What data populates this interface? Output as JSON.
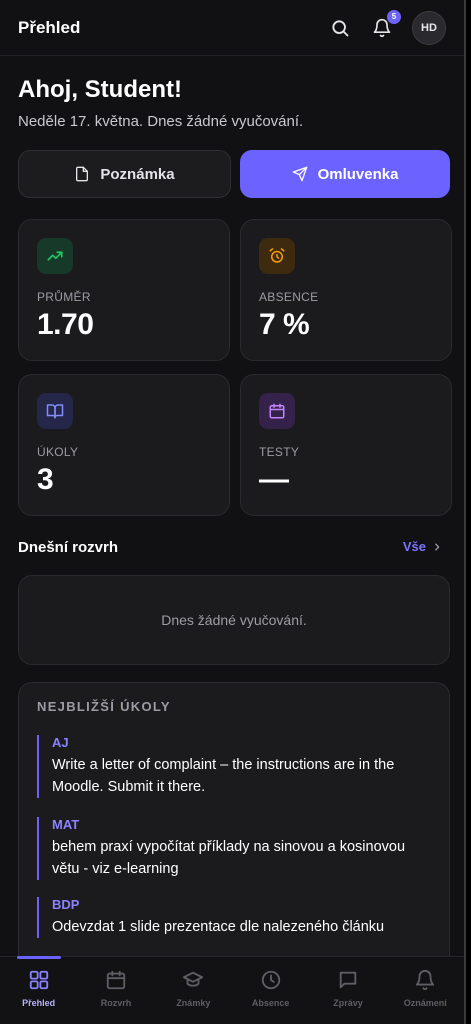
{
  "header": {
    "title": "Přehled",
    "notification_count": "5",
    "avatar_initials": "HD"
  },
  "greeting": {
    "title": "Ahoj, Student!",
    "subtitle": "Neděle 17. května. Dnes žádné vyučování."
  },
  "actions": {
    "note_label": "Poznámka",
    "excuse_label": "Omluvenka"
  },
  "stats": {
    "average": {
      "label": "PRŮMĚR",
      "value": "1.70",
      "icon": "trending-up-icon",
      "color": "#22c55e"
    },
    "absence": {
      "label": "ABSENCE",
      "value": "7 %",
      "icon": "alarm-clock-icon",
      "color": "#f59e0b"
    },
    "homework": {
      "label": "ÚKOLY",
      "value": "3",
      "icon": "open-book-icon",
      "color": "#818cf8"
    },
    "tests": {
      "label": "TESTY",
      "value": "—",
      "icon": "calendar-icon",
      "color": "#c084fc"
    }
  },
  "schedule": {
    "title": "Dnešní rozvrh",
    "link": "Vše",
    "empty": "Dnes žádné vyučování."
  },
  "tasks": {
    "title": "NEJBLIŽŠÍ ÚKOLY",
    "items": [
      {
        "subject": "AJ",
        "text": "Write a letter of complaint – the instructions are in the Moodle. Submit it there."
      },
      {
        "subject": "MAT",
        "text": "behem praxí vypočítat příklady na sinovou a kosinovou větu - viz e-learning"
      },
      {
        "subject": "BDP",
        "text": "Odevzdat 1 slide prezentace dle nalezeného článku"
      }
    ]
  },
  "nav": {
    "items": [
      {
        "label": "Přehled",
        "icon": "grid-icon",
        "active": true
      },
      {
        "label": "Rozvrh",
        "icon": "calendar-icon"
      },
      {
        "label": "Známky",
        "icon": "graduation-cap-icon"
      },
      {
        "label": "Absence",
        "icon": "clock-icon"
      },
      {
        "label": "Zprávy",
        "icon": "message-icon"
      },
      {
        "label": "Oznámení",
        "icon": "bell-icon"
      }
    ]
  },
  "colors": {
    "accent": "#6c63ff",
    "background": "#111113",
    "card": "#1b1b1e"
  }
}
